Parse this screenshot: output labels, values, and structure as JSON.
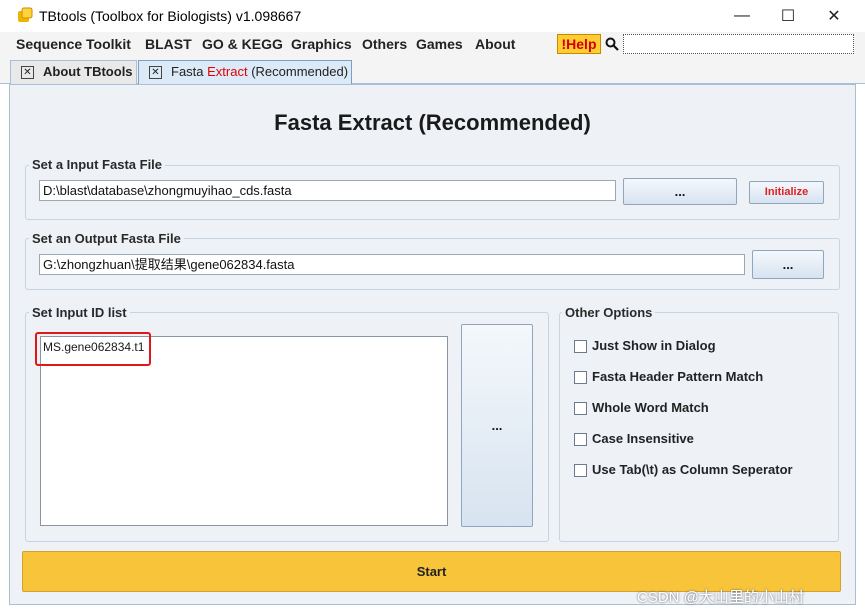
{
  "window": {
    "title": "TBtools (Toolbox for Biologists) v1.098667",
    "minimize_glyph": "—",
    "maximize_glyph": "☐",
    "close_glyph": "✕"
  },
  "menu": [
    "Sequence Toolkit",
    "BLAST",
    "GO & KEGG",
    "Graphics",
    "Others",
    "Games",
    "About"
  ],
  "help_label": "!Help",
  "tabs": {
    "about_label": "About TBtools",
    "fasta_prefix": "Fasta ",
    "fasta_red": "Extract",
    "fasta_suffix": " (Recommended)",
    "close_glyph": "✕"
  },
  "page_title": "Fasta Extract (Recommended)",
  "input_group": {
    "title": "Set a Input Fasta File",
    "path": "D:\\blast\\database\\zhongmuyihao_cds.fasta",
    "browse_label": "...",
    "initialize_label": "Initialize"
  },
  "output_group": {
    "title": "Set an Output Fasta File",
    "path": "G:\\zhongzhuan\\提取结果\\gene062834.fasta",
    "browse_label": "..."
  },
  "id_group": {
    "title": "Set Input ID list",
    "ids": "MS.gene062834.t1",
    "browse_label": "..."
  },
  "options": {
    "title": "Other Options",
    "items": [
      {
        "label": "Just Show in Dialog",
        "checked": false
      },
      {
        "label": "Fasta Header Pattern Match",
        "checked": false
      },
      {
        "label": "Whole Word Match",
        "checked": false
      },
      {
        "label": "Case Insensitive",
        "checked": false
      },
      {
        "label": "Use Tab(\\t) as Column Seperator",
        "checked": false
      }
    ]
  },
  "start_label": "Start",
  "watermark": "CSDN @大山里的小山村",
  "colors": {
    "help_bg": "#ffcc33",
    "help_text": "#d40000",
    "start_bg": "#f7c43a",
    "highlight": "#e01818",
    "panel_bg": "#eef2f7"
  }
}
